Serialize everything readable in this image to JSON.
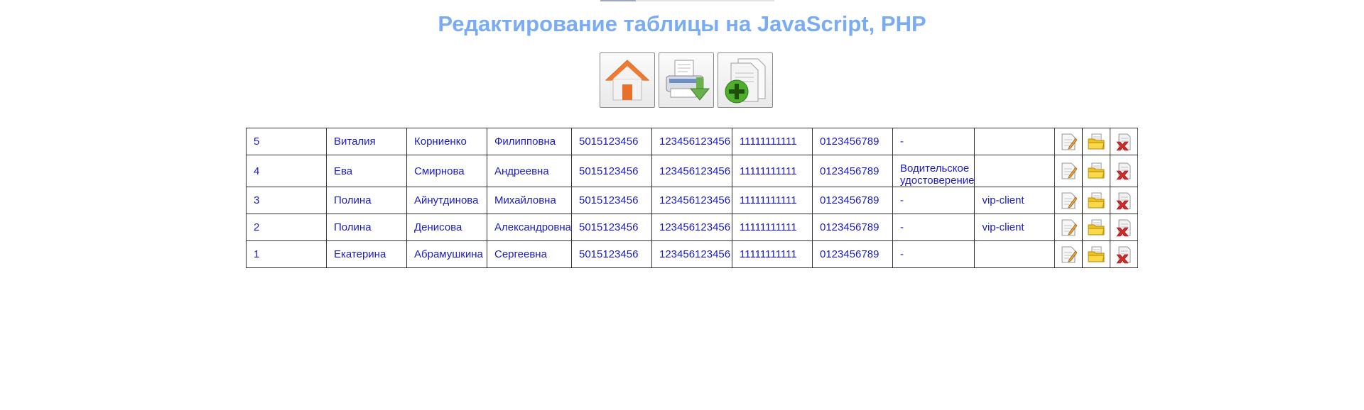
{
  "page": {
    "title": "Редактирование таблицы на JavaScript, PHP"
  },
  "toolbar": {
    "buttons": [
      {
        "name": "home",
        "icon": "home-icon"
      },
      {
        "name": "print-export",
        "icon": "printer-download-icon"
      },
      {
        "name": "add-record",
        "icon": "document-add-icon"
      }
    ]
  },
  "table": {
    "rows": [
      {
        "id": "5",
        "first_name": "Виталия",
        "last_name": "Корниенко",
        "patronymic": "Филипповна",
        "passport": "5015123456",
        "col5": "123456123456",
        "col6": "11111111111",
        "col7": "0123456789",
        "document": "-",
        "status": ""
      },
      {
        "id": "4",
        "first_name": "Ева",
        "last_name": "Смирнова",
        "patronymic": "Андреевна",
        "passport": "5015123456",
        "col5": "123456123456",
        "col6": "11111111111",
        "col7": "0123456789",
        "document": "Водительское удостоверение",
        "status": ""
      },
      {
        "id": "3",
        "first_name": "Полина",
        "last_name": "Айнутдинова",
        "patronymic": "Михайловна",
        "passport": "5015123456",
        "col5": "123456123456",
        "col6": "11111111111",
        "col7": "0123456789",
        "document": "-",
        "status": "vip-client"
      },
      {
        "id": "2",
        "first_name": "Полина",
        "last_name": "Денисова",
        "patronymic": "Александровна",
        "passport": "5015123456",
        "col5": "123456123456",
        "col6": "11111111111",
        "col7": "0123456789",
        "document": "-",
        "status": "vip-client"
      },
      {
        "id": "1",
        "first_name": "Екатерина",
        "last_name": "Абрамушкина",
        "patronymic": "Сергеевна",
        "passport": "5015123456",
        "col5": "123456123456",
        "col6": "11111111111",
        "col7": "0123456789",
        "document": "-",
        "status": ""
      }
    ],
    "row_actions": [
      "edit-icon",
      "open-folder-icon",
      "delete-icon"
    ]
  },
  "colors": {
    "title": "#7aabf5",
    "cell_text": "#1a1ac8",
    "grid": "#333333"
  }
}
